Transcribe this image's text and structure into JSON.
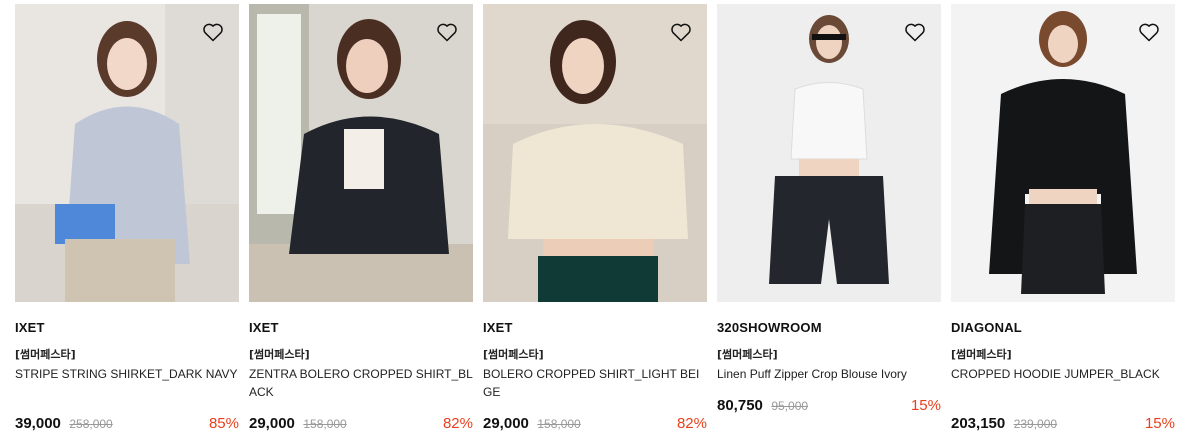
{
  "products": [
    {
      "brand": "IXET",
      "tag": "[썸머페스타]",
      "name": "STRIPE STRING SHIRKET_DARK NAVY",
      "price": "39,000",
      "original_price": "258,000",
      "discount": "85%",
      "wished": false
    },
    {
      "brand": "IXET",
      "tag": "[썸머페스타]",
      "name": "ZENTRA BOLERO CROPPED SHIRT_BLACK",
      "price": "29,000",
      "original_price": "158,000",
      "discount": "82%",
      "wished": false
    },
    {
      "brand": "IXET",
      "tag": "[썸머페스타]",
      "name": "BOLERO CROPPED SHIRT_LIGHT BEIGE",
      "price": "29,000",
      "original_price": "158,000",
      "discount": "82%",
      "wished": false
    },
    {
      "brand": "320SHOWROOM",
      "tag": "[썸머페스타]",
      "name": "Linen Puff Zipper Crop Blouse Ivory",
      "price": "80,750",
      "original_price": "95,000",
      "discount": "15%",
      "wished": false
    },
    {
      "brand": "DIAGONAL",
      "tag": "[썸머페스타]",
      "name": "CROPPED HOODIE JUMPER_BLACK",
      "price": "203,150",
      "original_price": "239,000",
      "discount": "15%",
      "wished": false
    }
  ],
  "colors": {
    "discount": "#e8401d",
    "strike": "#999999"
  },
  "icons": {
    "wishlist": "heart-outline-icon"
  }
}
